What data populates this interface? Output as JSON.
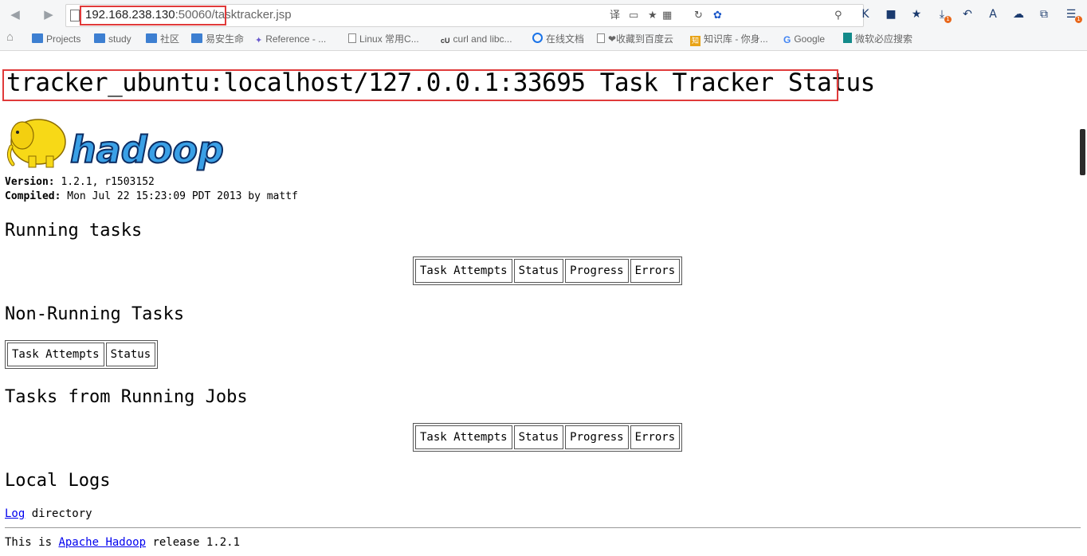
{
  "browser": {
    "url_host": "192.168.238.130",
    "url_port": ":50060",
    "url_path": "/tasktracker.jsp",
    "bookmarks": [
      {
        "label": "Projects",
        "icon": "folder-icon"
      },
      {
        "label": "study",
        "icon": "folder-icon"
      },
      {
        "label": "社区",
        "icon": "folder-icon"
      },
      {
        "label": "易安生命",
        "icon": "folder-icon"
      },
      {
        "label": "Reference - ...",
        "icon": "reference-icon"
      },
      {
        "label": "Linux 常用C...",
        "icon": "page-icon"
      },
      {
        "label": "curl and libc...",
        "icon": "curl-icon"
      },
      {
        "label": "在线文档",
        "icon": "online-doc-icon"
      },
      {
        "label": "❤收藏到百度云",
        "icon": "page-icon"
      },
      {
        "label": "知识库 - 你身...",
        "icon": "zhi-icon"
      },
      {
        "label": "Google",
        "icon": "google-icon"
      },
      {
        "label": "微软必应搜索",
        "icon": "bing-icon"
      }
    ],
    "download_badge": "1",
    "menu_badge": "1"
  },
  "page": {
    "title": "tracker_ubuntu:localhost/127.0.0.1:33695 Task Tracker Status",
    "logo_text": "hadoop",
    "version_label": "Version:",
    "version_value": " 1.2.1, r1503152",
    "compiled_label": "Compiled:",
    "compiled_value": " Mon Jul 22 15:23:09 PDT 2013 by mattf",
    "running_heading": "Running tasks",
    "running_columns": [
      "Task Attempts",
      "Status",
      "Progress",
      "Errors"
    ],
    "nonrunning_heading": "Non-Running Tasks",
    "nonrunning_columns": [
      "Task Attempts",
      "Status"
    ],
    "jobs_heading": "Tasks from Running Jobs",
    "jobs_columns": [
      "Task Attempts",
      "Status",
      "Progress",
      "Errors"
    ],
    "logs_heading": "Local Logs",
    "log_link": "Log",
    "log_suffix": " directory",
    "footer_prefix": "This is ",
    "footer_link": "Apache Hadoop",
    "footer_suffix": " release 1.2.1"
  },
  "colors": {
    "highlight": "#e03a3a",
    "link": "#0000ee",
    "logo_blue": "#3aa0e6",
    "elephant_yellow": "#f7d917"
  }
}
